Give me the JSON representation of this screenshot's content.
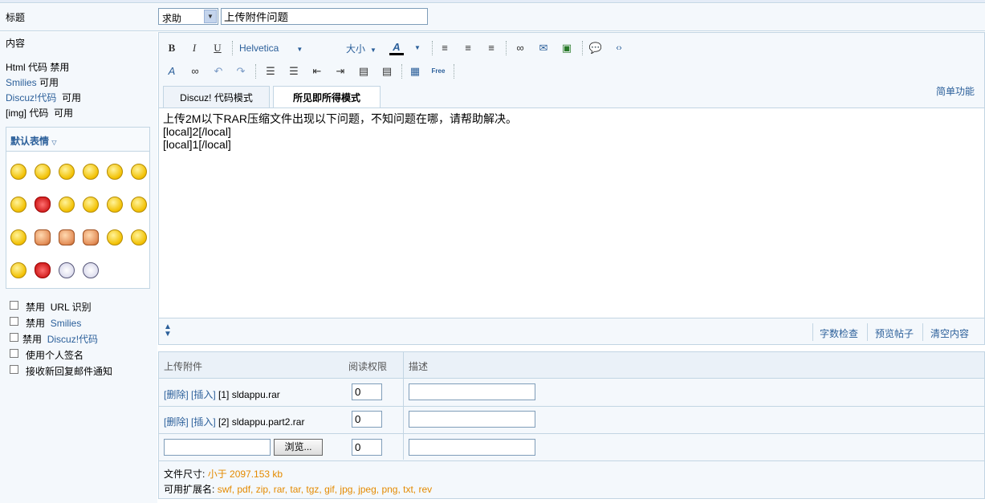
{
  "title_row": {
    "label": "标题",
    "type_value": "求助",
    "subject_value": "上传附件问题"
  },
  "left": {
    "content_label": "内容",
    "html_code": {
      "name": "Html 代码",
      "status": "禁用"
    },
    "smilies": {
      "name": "Smilies",
      "status": "可用"
    },
    "discuz_code": {
      "name": "Discuz!代码",
      "status": "可用"
    },
    "img_code": {
      "name": "[img] 代码",
      "status": "可用"
    },
    "smilies_panel_title": "默认表情",
    "options": [
      {
        "prefix": "禁用",
        "label": "URL 识别",
        "checked": false
      },
      {
        "prefix": "禁用",
        "label": "Smilies",
        "checked": false
      },
      {
        "prefix": "禁用",
        "label": "Discuz!代码",
        "checked": false
      },
      {
        "prefix": "",
        "label": "使用个人签名",
        "checked": false
      },
      {
        "prefix": "",
        "label": "接收新回复邮件通知",
        "checked": false
      }
    ]
  },
  "editor": {
    "font_name": "Helvetica",
    "font_size": "大小",
    "tabs": [
      {
        "label": "Discuz! 代码模式",
        "active": false
      },
      {
        "label": "所见即所得模式",
        "active": true
      }
    ],
    "simple_mode": "简单功能",
    "content_lines": [
      "上传2M以下RAR压缩文件出现以下问题，不知问题在哪，请帮助解决。",
      "[local]2[/local]",
      "[local]1[/local]"
    ],
    "footer": {
      "word_check": "字数检查",
      "preview": "预览帖子",
      "clear": "清空内容"
    }
  },
  "upload": {
    "header": {
      "attachment": "上传附件",
      "permission": "阅读权限",
      "description": "描述"
    },
    "rows": [
      {
        "delete": "[删除]",
        "insert": "[插入]",
        "index": "[1]",
        "filename": "sldappu.rar",
        "permission": "0",
        "description": ""
      },
      {
        "delete": "[删除]",
        "insert": "[插入]",
        "index": "[2]",
        "filename": "sldappu.part2.rar",
        "permission": "0",
        "description": ""
      }
    ],
    "new_row": {
      "browse": "浏览...",
      "permission": "0"
    },
    "size_label": "文件尺寸:",
    "size_value": "小于  2097.153 kb",
    "ext_label": "可用扩展名:",
    "ext_value": "swf, pdf, zip, rar, tar, tgz, gif, jpg, jpeg, png, txt, rev"
  }
}
